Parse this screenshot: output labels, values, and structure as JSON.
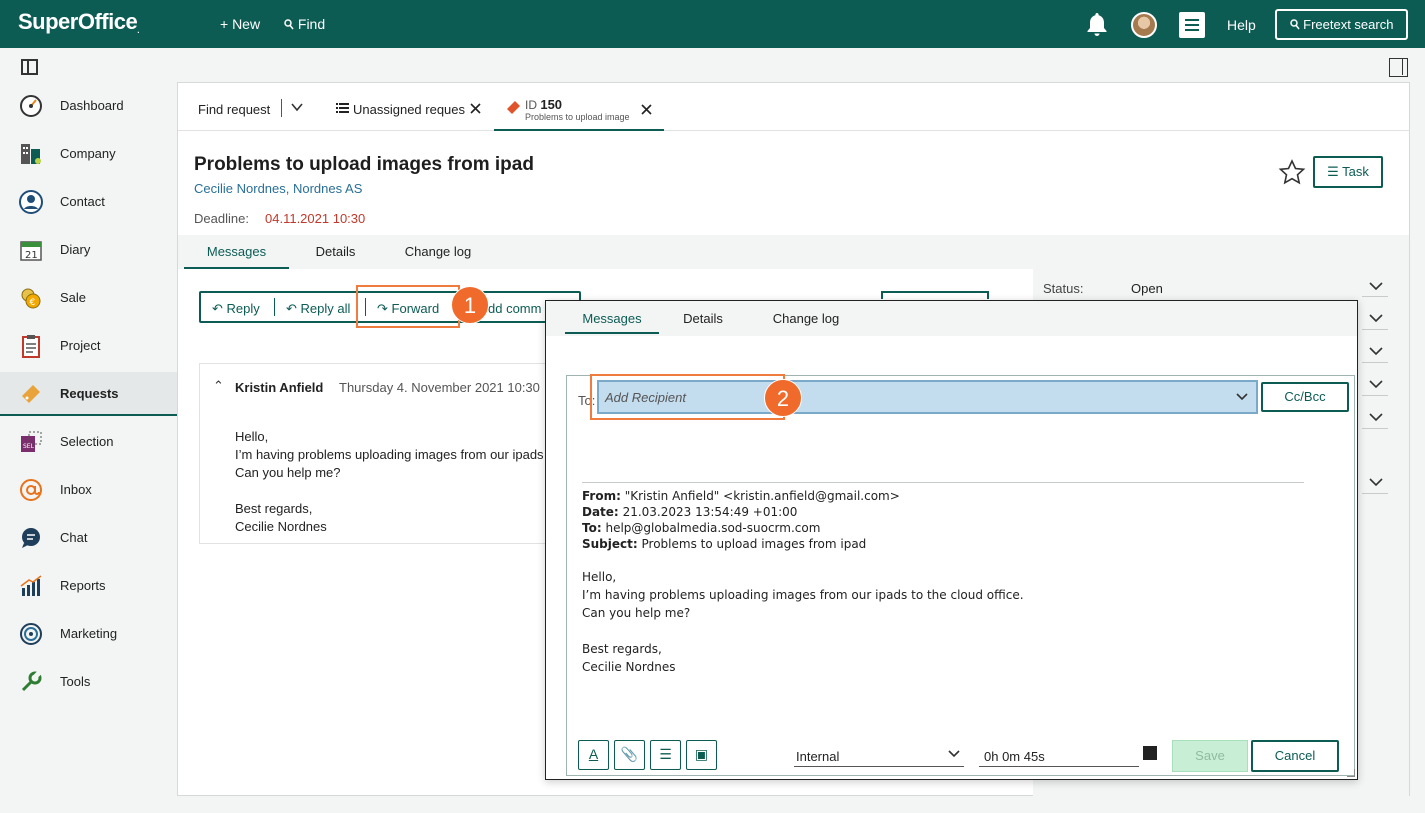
{
  "topbar": {
    "logo": "SuperOffice",
    "logo_mark": ".",
    "new_label": "+ New",
    "find_label": "Find",
    "help_label": "Help",
    "freetext_label": "Freetext search",
    "icons": [
      "bell-icon",
      "avatar",
      "menu-icon",
      "search-icon"
    ]
  },
  "sidebar": {
    "items": [
      {
        "label": "Dashboard",
        "icon": "gauge-icon"
      },
      {
        "label": "Company",
        "icon": "building-icon"
      },
      {
        "label": "Contact",
        "icon": "person-icon"
      },
      {
        "label": "Diary",
        "icon": "calendar-icon"
      },
      {
        "label": "Sale",
        "icon": "coins-icon"
      },
      {
        "label": "Project",
        "icon": "clipboard-icon"
      },
      {
        "label": "Requests",
        "icon": "ticket-icon",
        "active": true
      },
      {
        "label": "Selection",
        "icon": "selection-icon"
      },
      {
        "label": "Inbox",
        "icon": "at-icon"
      },
      {
        "label": "Chat",
        "icon": "chat-icon"
      },
      {
        "label": "Reports",
        "icon": "bar-chart-icon"
      },
      {
        "label": "Marketing",
        "icon": "target-icon"
      },
      {
        "label": "Tools",
        "icon": "wrench-icon"
      }
    ]
  },
  "tabs": {
    "find_request": "Find request",
    "unassigned": "Unassigned reques",
    "active_id_prefix": "ID",
    "active_id": "150",
    "active_sub": "Problems to upload image"
  },
  "request": {
    "title": "Problems to upload images from ipad",
    "subtitle": "Cecilie Nordnes, Nordnes AS",
    "deadline_label": "Deadline:",
    "deadline_value": "04.11.2021 10:30",
    "task_label": "Task"
  },
  "subtabs": [
    "Messages",
    "Details",
    "Change log"
  ],
  "actions": {
    "reply": "Reply",
    "reply_all": "Reply all",
    "forward": "Forward",
    "add_comment": "dd comm"
  },
  "badges": {
    "first": "1",
    "second": "2"
  },
  "message": {
    "from": "Kristin Anfield",
    "date": "Thursday 4. November 2021 10:30",
    "body": [
      "Hello,",
      "I’m having problems uploading images from our ipads to the cloud office.",
      "Can you help me?",
      "",
      "Best regards,",
      "Cecilie Nordnes"
    ]
  },
  "side": {
    "status_label": "Status:",
    "status_value": "Open"
  },
  "dialog": {
    "tabs": [
      "Messages",
      "Details",
      "Change log"
    ],
    "to_label": "To:",
    "to_placeholder": "Add Recipient",
    "ccbcc": "Cc/Bcc",
    "fwd": {
      "from_label": "From:",
      "from_value": "\"Kristin Anfield\" <kristin.anfield@gmail.com>",
      "date_label": "Date:",
      "date_value": "21.03.2023 13:54:49 +01:00",
      "to_label": "To:",
      "to_value": "help@globalmedia.sod-suocrm.com",
      "subject_label": "Subject:",
      "subject_value": "Problems to upload images from ipad"
    },
    "body": [
      "Hello,",
      "I’m having problems uploading images from our ipads to the cloud office.",
      "Can you help me?",
      "",
      "Best regards,",
      "Cecilie Nordnes"
    ],
    "visibility": "Internal",
    "timer": "0h 0m 45s",
    "save": "Save",
    "cancel": "Cancel"
  },
  "colors": {
    "brand": "#0c5c54",
    "highlight": "#f07b3f",
    "badge": "#ef6a2b",
    "deadline": "#c0392b",
    "recipient_bg": "#c3dcee"
  }
}
